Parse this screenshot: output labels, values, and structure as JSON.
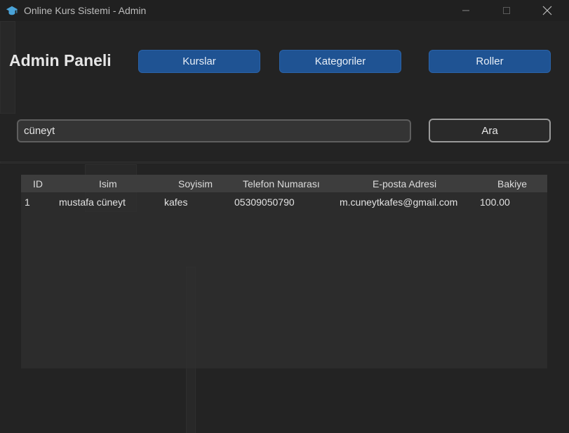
{
  "window": {
    "title": "Online Kurs Sistemi - Admin",
    "controls": {
      "minimize": "minimize-icon",
      "maximize": "maximize-icon",
      "close": "close-icon"
    }
  },
  "header": {
    "title": "Admin Paneli",
    "buttons": {
      "courses": "Kurslar",
      "categories": "Kategoriler",
      "roles": "Roller"
    }
  },
  "search": {
    "value": "cüneyt",
    "button_label": "Ara"
  },
  "table": {
    "columns": [
      "ID",
      "Isim",
      "Soyisim",
      "Telefon Numarası",
      "E-posta Adresi",
      "Bakiye"
    ],
    "rows": [
      [
        "1",
        "mustafa cüneyt",
        "kafes",
        "05309050790",
        "m.cuneytkafes@gmail.com",
        "100.00"
      ]
    ]
  },
  "colors": {
    "accent_button": "#1f5393",
    "window_bg": "#232323",
    "table_header_bg": "#3f3f3f"
  }
}
